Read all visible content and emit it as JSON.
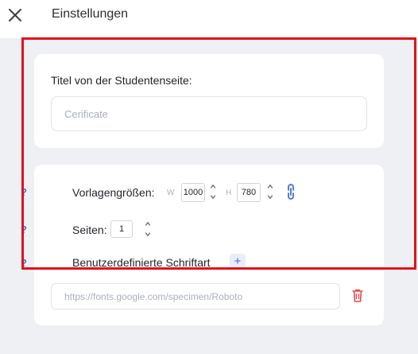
{
  "header": {
    "title": "Einstellungen",
    "close_icon": "close-icon"
  },
  "student_page": {
    "label": "Titel von der Studentenseite:",
    "placeholder": "Cerificate",
    "value": ""
  },
  "template_size": {
    "help": "?",
    "label": "Vorlagengrößen:",
    "width_letter": "W",
    "width_value": "1000",
    "height_letter": "H",
    "height_value": "780",
    "link_icon": "link-icon"
  },
  "pages": {
    "help": "?",
    "label": "Seiten:",
    "value": "1"
  },
  "custom_font": {
    "help": "?",
    "label": "Benutzerdefinierte Schriftart",
    "add_label": "+",
    "placeholder": "https://fonts.google.com/specimen/Roboto",
    "delete_icon": "trash-icon"
  },
  "colors": {
    "accent": "#3d6fd8",
    "delete": "#e5484d",
    "highlight": "#e0131c",
    "background": "#eef0f3"
  }
}
